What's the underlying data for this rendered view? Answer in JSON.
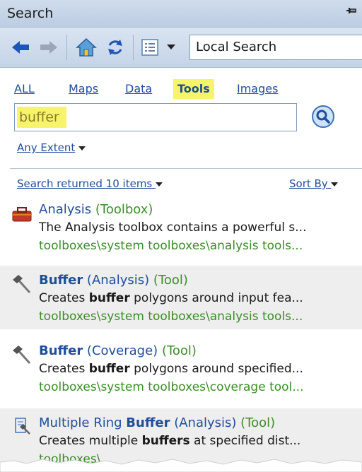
{
  "window": {
    "title": "Search",
    "pin_icon": "pin-icon"
  },
  "toolbar": {
    "back_icon": "back-arrow-icon",
    "forward_icon": "forward-arrow-icon",
    "home_icon": "home-icon",
    "refresh_icon": "refresh-icon",
    "view_icon": "details-view-icon",
    "dropdown_icon": "chevron-down-icon",
    "location": "Local Search"
  },
  "tabs": [
    "ALL",
    "Maps",
    "Data",
    "Tools",
    "Images"
  ],
  "active_tab": "Tools",
  "search": {
    "query": "buffer",
    "button_icon": "search-icon"
  },
  "extent": {
    "label": "Any Extent"
  },
  "results": {
    "count_label": "Search returned 10 items",
    "sort_label": "Sort By",
    "items": [
      {
        "icon": "toolbox-icon",
        "name": "Analysis",
        "name_bold": "",
        "type_paren": " (Toolbox)",
        "desc_pre": "The Analysis toolbox contains a powerful s...",
        "desc_bold": "",
        "desc_post": "",
        "path": "toolboxes\\system toolboxes\\analysis tools..."
      },
      {
        "icon": "hammer-icon",
        "name": "",
        "name_bold": "Buffer",
        "name_post": " (Analysis)",
        "type_paren": " (Tool)",
        "desc_pre": "Creates ",
        "desc_bold": "buffer",
        "desc_post": " polygons around input fea...",
        "path": "toolboxes\\system toolboxes\\analysis tools..."
      },
      {
        "icon": "hammer-icon",
        "name": "",
        "name_bold": "Buffer",
        "name_post": " (Coverage)",
        "type_paren": " (Tool)",
        "desc_pre": "Creates ",
        "desc_bold": "buffer",
        "desc_post": " polygons around specified...",
        "path": "toolboxes\\system toolboxes\\coverage tool..."
      },
      {
        "icon": "script-tool-icon",
        "name": "Multiple Ring ",
        "name_bold": "Buffer",
        "name_post": " (Analysis)",
        "type_paren": " (Tool)",
        "desc_pre": "Creates multiple ",
        "desc_bold": "buffers",
        "desc_post": " at specified dist...",
        "path": "toolboxes\\"
      }
    ]
  },
  "colors": {
    "highlight": "#f7f36b",
    "link": "#1f4e9a",
    "path": "#3c8c2a"
  }
}
